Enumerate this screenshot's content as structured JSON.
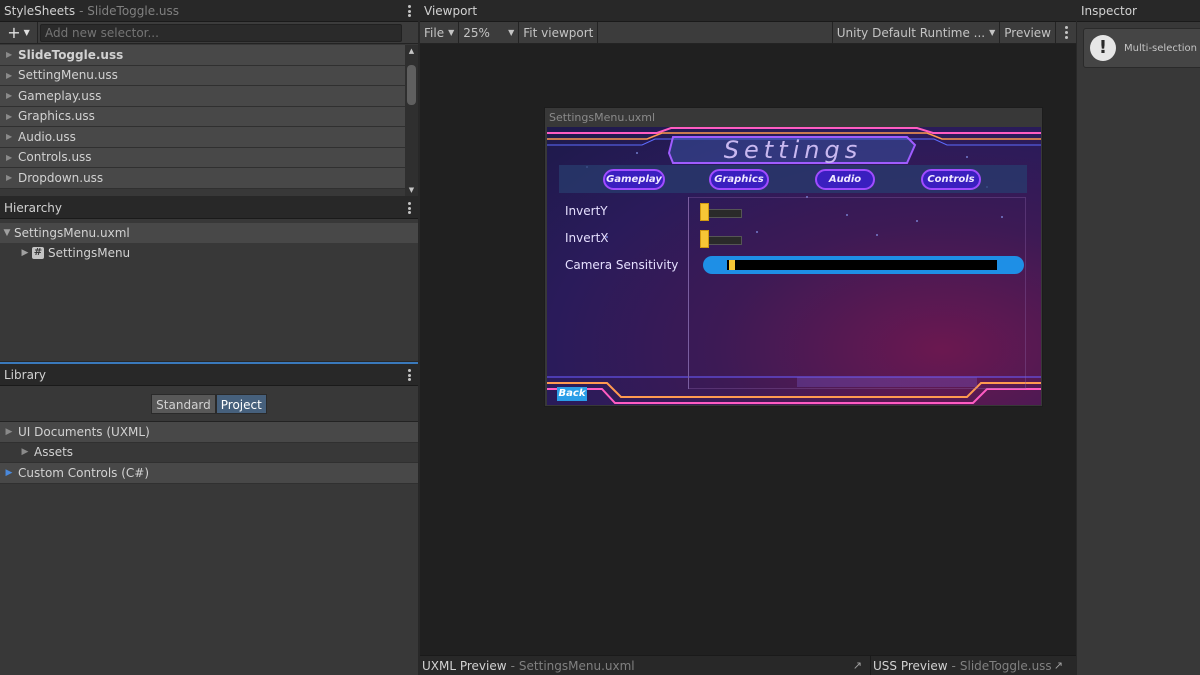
{
  "stylesheets": {
    "title": "StyleSheets",
    "subtitle": "SlideToggle.uss",
    "add_placeholder": "Add new selector...",
    "items": [
      {
        "label": "SlideToggle.uss"
      },
      {
        "label": "SettingMenu.uss"
      },
      {
        "label": "Gameplay.uss"
      },
      {
        "label": "Graphics.uss"
      },
      {
        "label": "Audio.uss"
      },
      {
        "label": "Controls.uss"
      },
      {
        "label": "Dropdown.uss"
      }
    ]
  },
  "hierarchy": {
    "title": "Hierarchy",
    "root": "SettingsMenu.uxml",
    "child": "SettingsMenu"
  },
  "library": {
    "title": "Library",
    "tabs": [
      "Standard",
      "Project"
    ],
    "active_tab": "Project",
    "rows": [
      {
        "label": "UI Documents (UXML)"
      },
      {
        "label": "Assets"
      },
      {
        "label": "Custom Controls (C#)"
      }
    ]
  },
  "viewport": {
    "title": "Viewport",
    "toolbar": {
      "file": "File",
      "zoom": "25%",
      "fit": "Fit viewport",
      "theme": "Unity Default Runtime ...",
      "preview": "Preview"
    },
    "document_label": "SettingsMenu.uxml",
    "bottom": {
      "uxml_label": "UXML Preview",
      "uxml_file": "SettingsMenu.uxml",
      "uss_label": "USS Preview",
      "uss_file": "SlideToggle.uss"
    }
  },
  "game": {
    "title": "Settings",
    "tabs": [
      "Gameplay",
      "Graphics",
      "Audio",
      "Controls"
    ],
    "options": [
      {
        "label": "InvertY"
      },
      {
        "label": "InvertX"
      },
      {
        "label": "Camera Sensitivity"
      }
    ],
    "back": "Back"
  },
  "inspector": {
    "title": "Inspector",
    "message": "Multi-selection e"
  },
  "colors": {
    "accent_blue": "#3a79bb",
    "tab_purple": "#a04cff",
    "toggle_yellow": "#f7c636",
    "slider_blue": "#1e8fe6"
  }
}
